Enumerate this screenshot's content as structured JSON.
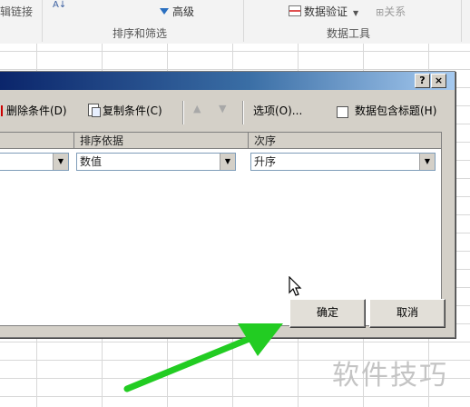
{
  "ribbon": {
    "link_label": "辑链接",
    "sort_asc_icon": "A↓",
    "advanced_label": "高级",
    "group_sort_filter": "排序和筛选",
    "data_validation_label": "数据验证",
    "relationships_label": "关系",
    "group_data_tools": "数据工具"
  },
  "dialog": {
    "help_btn": "?",
    "close_btn": "×",
    "delete_condition": "删除条件(D)",
    "copy_condition": "复制条件(C)",
    "options": "选项(O)...",
    "header_checkbox_label": "数据包含标题(H)",
    "columns": {
      "sort_on": "排序依据",
      "order": "次序"
    },
    "row": {
      "column_value": "",
      "sort_on_value": "数值",
      "order_value": "升序"
    },
    "ok": "确定",
    "cancel": "取消"
  },
  "watermark": "软件技巧",
  "colors": {
    "arrow": "#22cc22",
    "title_start": "#0a246a",
    "title_end": "#a6caf0"
  }
}
